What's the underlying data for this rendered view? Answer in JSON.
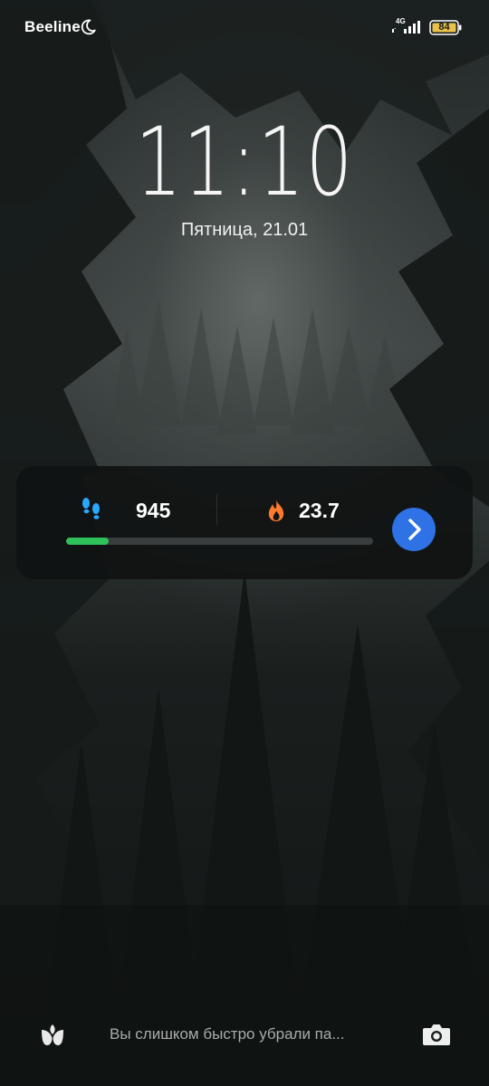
{
  "status_bar": {
    "carrier": "Beeline",
    "network": "4G",
    "battery": "84",
    "icons": [
      "moon-icon",
      "signal-icon",
      "battery-icon"
    ]
  },
  "lock_screen": {
    "time": "11:10",
    "date": "Пятница, 21.01"
  },
  "fitness_widget": {
    "steps": "945",
    "calories": "23.7",
    "progress": 0.14,
    "icons": [
      "steps-icon",
      "flame-icon",
      "chevron-right-icon"
    ],
    "colors": {
      "steps_icon": "#29a8ff",
      "flame_icon": "#ff7a2e",
      "progress_fill": "#2fc15a",
      "button": "#2e72e6"
    }
  },
  "bottom_bar": {
    "hint": "Вы слишком быстро убрали па...",
    "icons": [
      "flower-icon",
      "camera-icon"
    ]
  }
}
